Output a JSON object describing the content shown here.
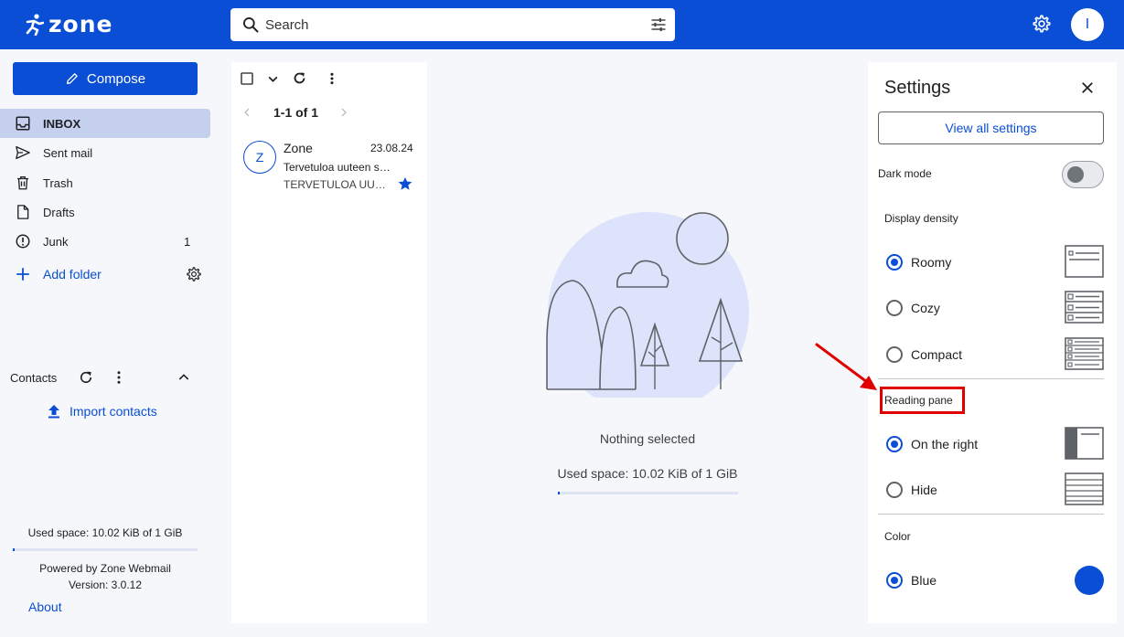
{
  "header": {
    "logo_text": "zone",
    "search_placeholder": "Search",
    "avatar_letter": "I"
  },
  "sidebar": {
    "compose_label": "Compose",
    "items": [
      {
        "label": "INBOX",
        "icon": "inbox-icon",
        "count": "",
        "active": true
      },
      {
        "label": "Sent mail",
        "icon": "send-icon",
        "count": ""
      },
      {
        "label": "Trash",
        "icon": "trash-icon",
        "count": ""
      },
      {
        "label": "Drafts",
        "icon": "draft-icon",
        "count": ""
      },
      {
        "label": "Junk",
        "icon": "junk-icon",
        "count": "1"
      }
    ],
    "add_folder_label": "Add folder",
    "contacts_label": "Contacts",
    "import_contacts_label": "Import contacts",
    "used_space": "Used space: 10.02 KiB of 1 GiB",
    "used_fraction": 0.01,
    "powered_by": "Powered by Zone Webmail",
    "version": "Version: 3.0.12",
    "about_label": "About"
  },
  "message_list": {
    "pager_text": "1-1 of 1",
    "messages": [
      {
        "avatar": "Z",
        "sender": "Zone",
        "date": "23.08.24",
        "subject": "Tervetuloa uuteen sähköpostiisi",
        "preview": "TERVETULOA UUTEEN SÄHKÖPOSTIISI",
        "starred": true
      }
    ]
  },
  "reading_pane": {
    "empty_text": "Nothing selected",
    "used_space": "Used space: 10.02 KiB of 1 GiB",
    "used_fraction": 0.01
  },
  "settings": {
    "title": "Settings",
    "view_all_label": "View all settings",
    "dark_mode_label": "Dark mode",
    "dark_mode_on": false,
    "display_density": {
      "label": "Display density",
      "options": [
        {
          "label": "Roomy",
          "selected": true
        },
        {
          "label": "Cozy",
          "selected": false
        },
        {
          "label": "Compact",
          "selected": false
        }
      ]
    },
    "reading_pane": {
      "label": "Reading pane",
      "options": [
        {
          "label": "On the right",
          "selected": true
        },
        {
          "label": "Hide",
          "selected": false
        }
      ]
    },
    "color": {
      "label": "Color",
      "options": [
        {
          "label": "Blue",
          "selected": true,
          "swatch": "#0b4ed6"
        }
      ]
    }
  },
  "colors": {
    "brand": "#0b4ed6",
    "annotation": "#e00000"
  }
}
